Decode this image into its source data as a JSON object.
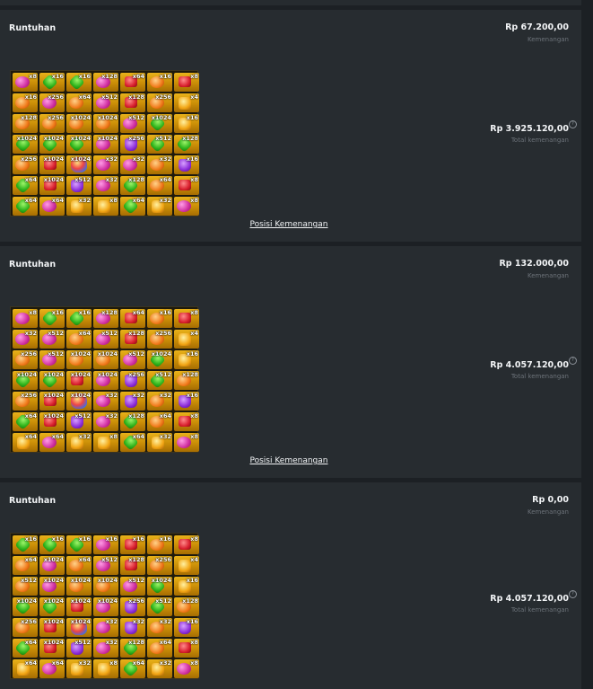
{
  "panels": [
    {
      "title": "Runtuhan",
      "win_amount": "Rp 67.200,00",
      "win_label": "Kemenangan",
      "total_amount": "Rp 3.925.120,00",
      "total_label": "Total kemenangan",
      "help_icon": "?",
      "link": "Posisi Kemenangan",
      "grid": [
        [
          [
            "pink",
            "x8"
          ],
          [
            "green",
            "x16"
          ],
          [
            "green",
            "x16"
          ],
          [
            "pink",
            "x128"
          ],
          [
            "red",
            "x64"
          ],
          [
            "orange",
            "x16"
          ],
          [
            "red",
            "x8"
          ]
        ],
        [
          [
            "orange",
            "x16"
          ],
          [
            "pink",
            "x256"
          ],
          [
            "orange",
            "x64"
          ],
          [
            "pink",
            "x512"
          ],
          [
            "red",
            "x128"
          ],
          [
            "orange",
            "x256"
          ],
          [
            "gold",
            "x4"
          ]
        ],
        [
          [
            "orange",
            "x128"
          ],
          [
            "orange",
            "x256"
          ],
          [
            "orange",
            "x1024"
          ],
          [
            "orange",
            "x1024"
          ],
          [
            "pink",
            "x512"
          ],
          [
            "green",
            "x1024"
          ],
          [
            "gold",
            "x16"
          ]
        ],
        [
          [
            "green",
            "x1024"
          ],
          [
            "green",
            "x1024"
          ],
          [
            "green",
            "x1024"
          ],
          [
            "pink",
            "x1024"
          ],
          [
            "purple",
            "x256"
          ],
          [
            "green",
            "x512"
          ],
          [
            "green",
            "x128"
          ]
        ],
        [
          [
            "orange",
            "x256"
          ],
          [
            "red",
            "x1024"
          ],
          [
            "scatter",
            "x1024"
          ],
          [
            "pink",
            "x32"
          ],
          [
            "pink",
            "x32"
          ],
          [
            "orange",
            "x32"
          ],
          [
            "purple",
            "x16"
          ]
        ],
        [
          [
            "green",
            "x64"
          ],
          [
            "red",
            "x1024"
          ],
          [
            "purple",
            "x512"
          ],
          [
            "pink",
            "x32"
          ],
          [
            "green",
            "x128"
          ],
          [
            "orange",
            "x64"
          ],
          [
            "red",
            "x8"
          ]
        ],
        [
          [
            "green",
            "x64"
          ],
          [
            "pink",
            "x64"
          ],
          [
            "gold",
            "x32"
          ],
          [
            "gold",
            "x8"
          ],
          [
            "green",
            "x64"
          ],
          [
            "gold",
            "x32"
          ],
          [
            "pink",
            "x8"
          ]
        ]
      ]
    },
    {
      "title": "Runtuhan",
      "win_amount": "Rp 132.000,00",
      "win_label": "Kemenangan",
      "total_amount": "Rp 4.057.120,00",
      "total_label": "Total kemenangan",
      "help_icon": "?",
      "link": "Posisi Kemenangan",
      "grid": [
        [
          [
            "pink",
            "x8"
          ],
          [
            "green",
            "x16"
          ],
          [
            "green",
            "x16"
          ],
          [
            "pink",
            "x128"
          ],
          [
            "red",
            "x64"
          ],
          [
            "orange",
            "x16"
          ],
          [
            "red",
            "x8"
          ]
        ],
        [
          [
            "pink",
            "x32"
          ],
          [
            "pink",
            "x512"
          ],
          [
            "orange",
            "x64"
          ],
          [
            "pink",
            "x512"
          ],
          [
            "red",
            "x128"
          ],
          [
            "orange",
            "x256"
          ],
          [
            "gold",
            "x4"
          ]
        ],
        [
          [
            "orange",
            "x256"
          ],
          [
            "pink",
            "x512"
          ],
          [
            "orange",
            "x1024"
          ],
          [
            "orange",
            "x1024"
          ],
          [
            "pink",
            "x512"
          ],
          [
            "green",
            "x1024"
          ],
          [
            "gold",
            "x16"
          ]
        ],
        [
          [
            "green",
            "x1024"
          ],
          [
            "green",
            "x1024"
          ],
          [
            "red",
            "x1024"
          ],
          [
            "pink",
            "x1024"
          ],
          [
            "purple",
            "x256"
          ],
          [
            "green",
            "x512"
          ],
          [
            "orange",
            "x128"
          ]
        ],
        [
          [
            "orange",
            "x256"
          ],
          [
            "red",
            "x1024"
          ],
          [
            "scatter",
            "x1024"
          ],
          [
            "pink",
            "x32"
          ],
          [
            "purple",
            "x32"
          ],
          [
            "orange",
            "x32"
          ],
          [
            "purple",
            "x16"
          ]
        ],
        [
          [
            "green",
            "x64"
          ],
          [
            "red",
            "x1024"
          ],
          [
            "purple",
            "x512"
          ],
          [
            "pink",
            "x32"
          ],
          [
            "green",
            "x128"
          ],
          [
            "orange",
            "x64"
          ],
          [
            "red",
            "x8"
          ]
        ],
        [
          [
            "gold",
            "x64"
          ],
          [
            "pink",
            "x64"
          ],
          [
            "gold",
            "x32"
          ],
          [
            "gold",
            "x8"
          ],
          [
            "green",
            "x64"
          ],
          [
            "gold",
            "x32"
          ],
          [
            "pink",
            "x8"
          ]
        ]
      ]
    },
    {
      "title": "Runtuhan",
      "win_amount": "Rp 0,00",
      "win_label": "Kemenangan",
      "total_amount": "Rp 4.057.120,00",
      "total_label": "Total kemenangan",
      "help_icon": "?",
      "link": "",
      "grid": [
        [
          [
            "green",
            "x16"
          ],
          [
            "green",
            "x16"
          ],
          [
            "green",
            "x16"
          ],
          [
            "pink",
            "x16"
          ],
          [
            "red",
            "x16"
          ],
          [
            "orange",
            "x16"
          ],
          [
            "red",
            "x8"
          ]
        ],
        [
          [
            "orange",
            "x64"
          ],
          [
            "pink",
            "x1024"
          ],
          [
            "orange",
            "x64"
          ],
          [
            "pink",
            "x512"
          ],
          [
            "red",
            "x128"
          ],
          [
            "orange",
            "x256"
          ],
          [
            "gold",
            "x4"
          ]
        ],
        [
          [
            "orange",
            "x512"
          ],
          [
            "pink",
            "x1024"
          ],
          [
            "orange",
            "x1024"
          ],
          [
            "orange",
            "x1024"
          ],
          [
            "pink",
            "x512"
          ],
          [
            "green",
            "x1024"
          ],
          [
            "gold",
            "x16"
          ]
        ],
        [
          [
            "green",
            "x1024"
          ],
          [
            "green",
            "x1024"
          ],
          [
            "red",
            "x1024"
          ],
          [
            "pink",
            "x1024"
          ],
          [
            "purple",
            "x256"
          ],
          [
            "green",
            "x512"
          ],
          [
            "orange",
            "x128"
          ]
        ],
        [
          [
            "orange",
            "x256"
          ],
          [
            "red",
            "x1024"
          ],
          [
            "scatter",
            "x1024"
          ],
          [
            "pink",
            "x32"
          ],
          [
            "purple",
            "x32"
          ],
          [
            "orange",
            "x32"
          ],
          [
            "purple",
            "x16"
          ]
        ],
        [
          [
            "green",
            "x64"
          ],
          [
            "red",
            "x1024"
          ],
          [
            "purple",
            "x512"
          ],
          [
            "pink",
            "x32"
          ],
          [
            "green",
            "x128"
          ],
          [
            "orange",
            "x64"
          ],
          [
            "red",
            "x8"
          ]
        ],
        [
          [
            "gold",
            "x64"
          ],
          [
            "pink",
            "x64"
          ],
          [
            "gold",
            "x32"
          ],
          [
            "gold",
            "x8"
          ],
          [
            "green",
            "x64"
          ],
          [
            "gold",
            "x32"
          ],
          [
            "pink",
            "x8"
          ]
        ]
      ]
    }
  ]
}
